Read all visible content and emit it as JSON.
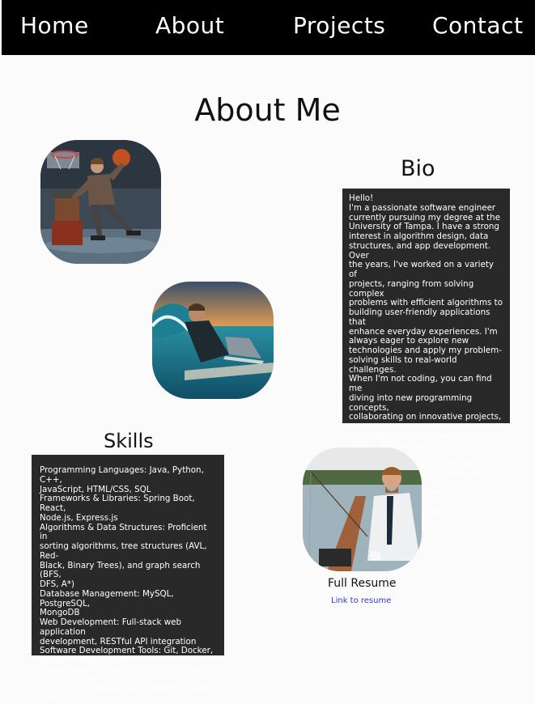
{
  "nav": {
    "home": "Home",
    "about": "About",
    "projects": "Projects",
    "contact": "Contact"
  },
  "page_title": "About Me",
  "bio": {
    "heading": "Bio",
    "lines": [
      "Hello!",
      "I'm a passionate software engineer",
      "currently pursuing my degree at the",
      "University of Tampa. I have a strong",
      "interest in algorithm design, data",
      "structures, and app development. Over",
      "the years, I've worked on a variety of",
      "projects, ranging from solving complex",
      "problems with efficient algorithms to",
      "building user-friendly applications that",
      "enhance everyday experiences. I'm",
      "always eager to explore new",
      "technologies and apply my problem-",
      "solving skills to real-world challenges.",
      "When I'm not coding, you can find me",
      "diving into new programming concepts,",
      "collaborating on innovative projects, or",
      "enjoying the vibrant campus life in",
      "Tampa. I'm excited to continue growing",
      "as a developer and contribute to",
      "projects that make a meaningful impact.",
      "Feel free to explore my portfolio to see",
      "some of my latest work!"
    ]
  },
  "skills": {
    "heading": "Skills",
    "lines": [
      "Programming Languages: Java, Python, C++,",
      "JavaScript, HTML/CSS, SQL",
      "Frameworks & Libraries: Spring Boot, React,",
      "Node.js, Express.js",
      "Algorithms & Data Structures: Proficient in",
      "sorting algorithms, tree structures (AVL, Red-",
      "Black, Binary Trees), and graph search (BFS,",
      "DFS, A*)",
      "Database Management: MySQL, PostgreSQL,",
      "MongoDB",
      "Web Development: Full-stack web application",
      "development, RESTful API integration",
      "Software Development Tools: Git, Docker,",
      "Jenkins, Maven, Gradle",
      "Cloud Platforms: AWS (EC2, S3), Microsoft",
      "Azure, Google Cloud",
      "Mobile App Development: Android Studio,",
      "Flutter"
    ]
  },
  "resume": {
    "heading": "Full Resume",
    "link_text": "Link to resume"
  },
  "colors": {
    "nav_bg": "#000000",
    "box_bg": "#2a2929",
    "link": "#3333dd"
  }
}
